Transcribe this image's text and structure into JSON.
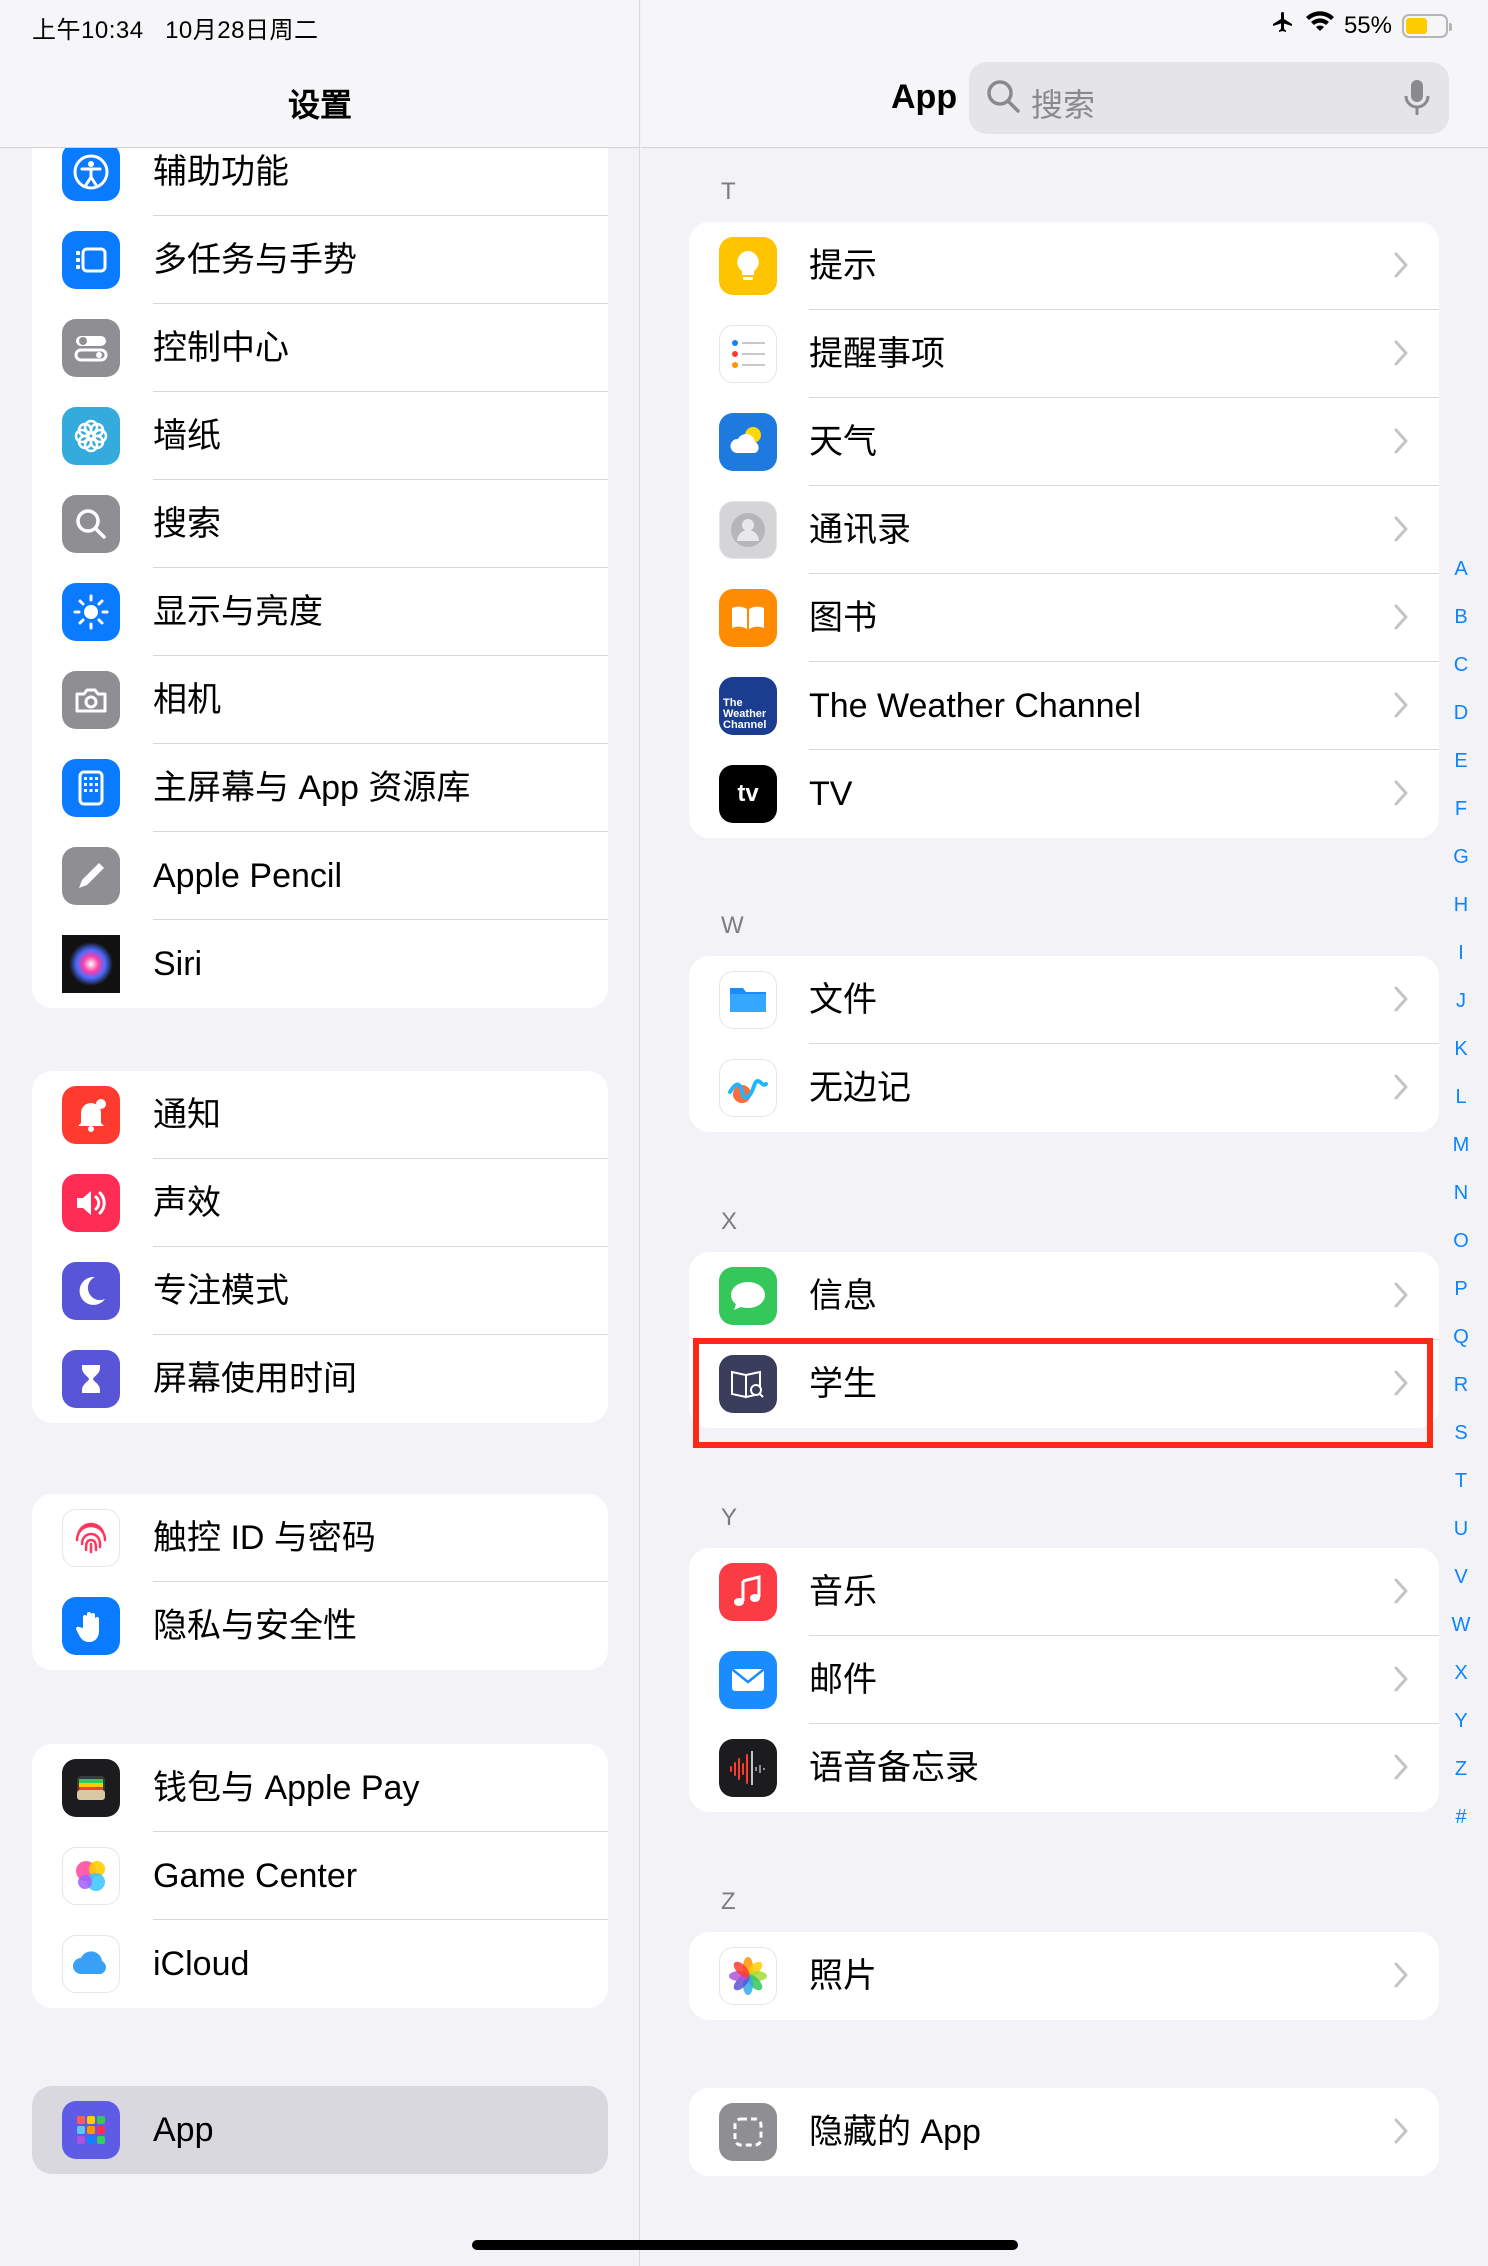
{
  "status": {
    "time": "上午10:34",
    "date": "10月28日周二",
    "battery": "55%",
    "battery_level": 0.55,
    "airplane_icon": "airplane-icon",
    "wifi_icon": "wifi-icon"
  },
  "left": {
    "title": "设置",
    "groups": [
      [
        {
          "label": "辅助功能",
          "icon": "accessibility-icon",
          "color": "#0a7aff"
        },
        {
          "label": "多任务与手势",
          "icon": "multitasking-icon",
          "color": "#0a7aff"
        },
        {
          "label": "控制中心",
          "icon": "control-center-icon",
          "color": "#8e8e93"
        },
        {
          "label": "墙纸",
          "icon": "wallpaper-icon",
          "color": "#35aadc"
        },
        {
          "label": "搜索",
          "icon": "search-icon",
          "color": "#8e8e93"
        },
        {
          "label": "显示与亮度",
          "icon": "brightness-icon",
          "color": "#0a7aff"
        },
        {
          "label": "相机",
          "icon": "camera-icon",
          "color": "#8e8e93"
        },
        {
          "label": "主屏幕与 App 资源库",
          "icon": "home-screen-icon",
          "color": "#0a7aff"
        },
        {
          "label": "Apple Pencil",
          "icon": "pencil-icon",
          "color": "#8e8e93"
        },
        {
          "label": "Siri",
          "icon": "siri-icon",
          "color": "#1c1c1e"
        }
      ],
      [
        {
          "label": "通知",
          "icon": "notifications-icon",
          "color": "#ff3b30"
        },
        {
          "label": "声效",
          "icon": "sounds-icon",
          "color": "#ff2d55"
        },
        {
          "label": "专注模式",
          "icon": "focus-moon-icon",
          "color": "#5856d6"
        },
        {
          "label": "屏幕使用时间",
          "icon": "hourglass-icon",
          "color": "#5856d6"
        }
      ],
      [
        {
          "label": "触控 ID 与密码",
          "icon": "fingerprint-icon",
          "color": "#ffffff"
        },
        {
          "label": "隐私与安全性",
          "icon": "privacy-hand-icon",
          "color": "#0a7aff"
        }
      ],
      [
        {
          "label": "钱包与 Apple Pay",
          "icon": "wallet-icon",
          "color": "#1c1c1e"
        },
        {
          "label": "Game Center",
          "icon": "game-center-icon",
          "color": "#ffffff"
        },
        {
          "label": "iCloud",
          "icon": "icloud-icon",
          "color": "#ffffff"
        }
      ],
      [
        {
          "label": "App",
          "icon": "apps-grid-icon",
          "color": "#5e5ce6",
          "selected": true
        }
      ]
    ]
  },
  "right": {
    "title": "App",
    "search_placeholder": "搜索",
    "sections": [
      {
        "letter": "T",
        "items": [
          {
            "label": "提示",
            "icon": "tips-bulb-icon",
            "color": "#ffc400"
          },
          {
            "label": "提醒事项",
            "icon": "reminders-icon",
            "color": "#ffffff"
          },
          {
            "label": "天气",
            "icon": "weather-icon",
            "color": "#1f7ae0"
          },
          {
            "label": "通讯录",
            "icon": "contacts-icon",
            "color": "#d5d5d8"
          },
          {
            "label": "图书",
            "icon": "books-icon",
            "color": "#ff8c00"
          },
          {
            "label": "The Weather Channel",
            "icon": "weather-channel-icon",
            "color": "#1a3d8f",
            "icon_text": "The Weather Channel"
          },
          {
            "label": "TV",
            "icon": "apple-tv-icon",
            "color": "#000000",
            "icon_text": "tv"
          }
        ]
      },
      {
        "letter": "W",
        "items": [
          {
            "label": "文件",
            "icon": "files-folder-icon",
            "color": "#ffffff"
          },
          {
            "label": "无边记",
            "icon": "freeform-icon",
            "color": "#ffffff"
          }
        ]
      },
      {
        "letter": "X",
        "items": [
          {
            "label": "信息",
            "icon": "messages-icon",
            "color": "#34c759"
          },
          {
            "label": "学生",
            "icon": "schoolwork-icon",
            "color": "#3a3d5c",
            "highlighted": true
          }
        ]
      },
      {
        "letter": "Y",
        "items": [
          {
            "label": "音乐",
            "icon": "music-note-icon",
            "color": "#fc3c44"
          },
          {
            "label": "邮件",
            "icon": "mail-icon",
            "color": "#1a8cff"
          },
          {
            "label": "语音备忘录",
            "icon": "voice-memos-icon",
            "color": "#1c1c1e"
          }
        ]
      },
      {
        "letter": "Z",
        "items": [
          {
            "label": "照片",
            "icon": "photos-icon",
            "color": "#ffffff"
          }
        ]
      },
      {
        "letter": "",
        "items": [
          {
            "label": "隐藏的 App",
            "icon": "hidden-apps-icon",
            "color": "#8e8e93"
          }
        ]
      }
    ],
    "index": [
      "A",
      "B",
      "C",
      "D",
      "E",
      "F",
      "G",
      "H",
      "I",
      "J",
      "K",
      "L",
      "M",
      "N",
      "O",
      "P",
      "Q",
      "R",
      "S",
      "T",
      "U",
      "V",
      "W",
      "X",
      "Y",
      "Z",
      "#"
    ]
  },
  "colors": {
    "accent": "#0a84ff",
    "highlight_border": "#ff2a16"
  }
}
